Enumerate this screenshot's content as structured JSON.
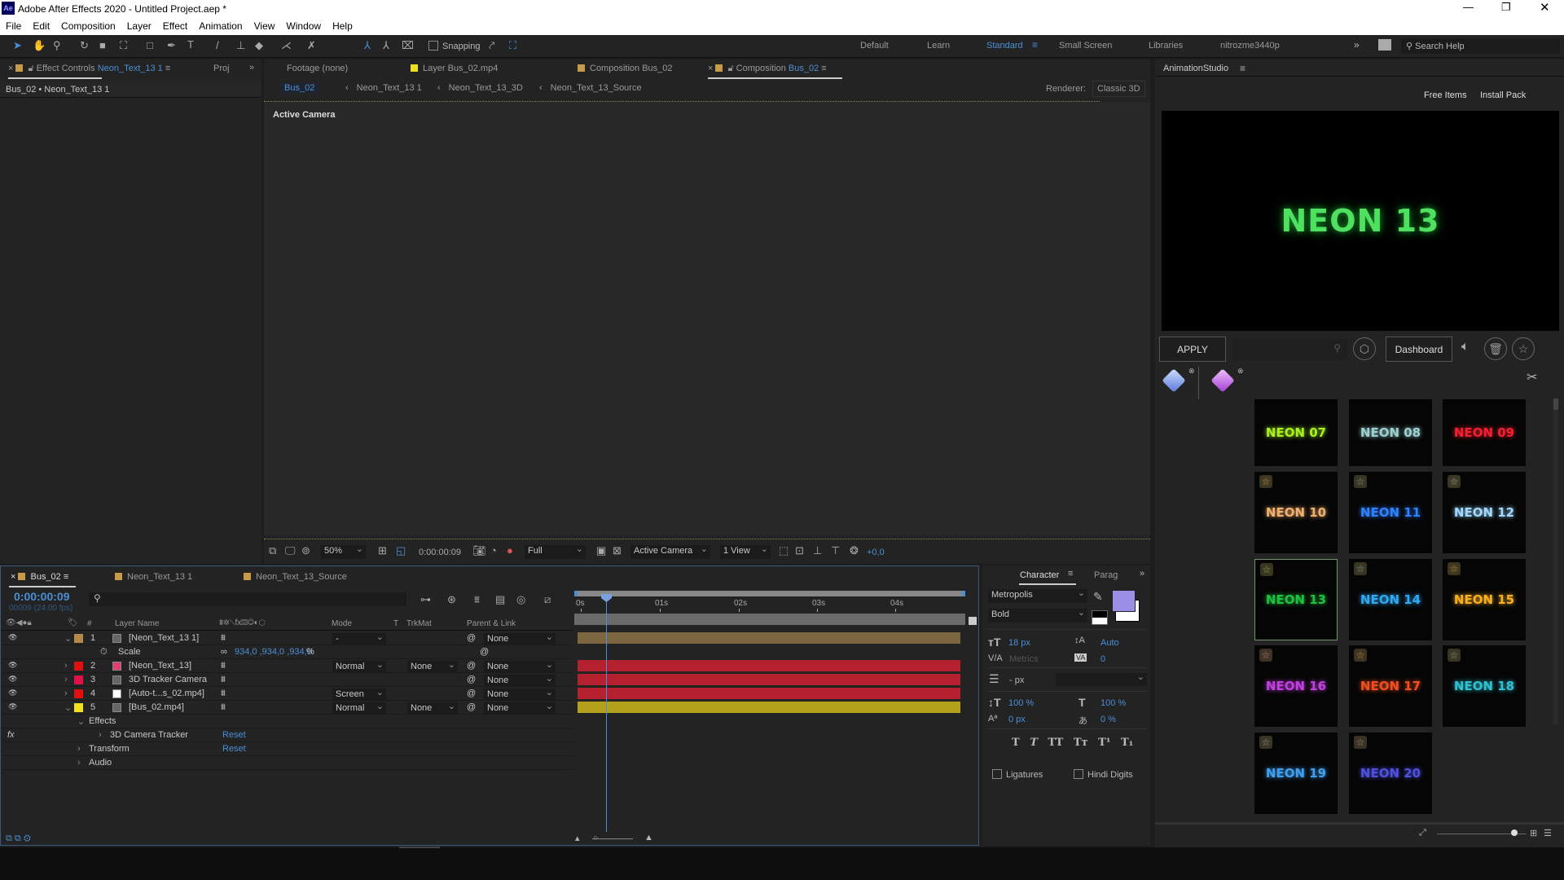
{
  "window": {
    "title": "Adobe After Effects 2020 - Untitled Project.aep *",
    "app_icon": "Ae"
  },
  "menu": [
    "File",
    "Edit",
    "Composition",
    "Layer",
    "Effect",
    "Animation",
    "View",
    "Window",
    "Help"
  ],
  "toolbar": {
    "snapping": "Snapping",
    "workspaces": [
      "Default",
      "Learn",
      "Standard",
      "Small Screen",
      "Libraries",
      "nitrozme3440p"
    ],
    "active_workspace": "Standard",
    "search_placeholder": "Search Help"
  },
  "effect_controls": {
    "tab_prefix": "Effect Controls",
    "tab_layer": "Neon_Text_13 1",
    "proj_tab": "Proj",
    "breadcrumb": "Bus_02 • Neon_Text_13 1"
  },
  "viewer": {
    "tabs": [
      "Footage (none)",
      "Layer Bus_02.mp4",
      "Composition Bus_02"
    ],
    "active_tab_prefix": "Composition",
    "active_tab_name": "Bus_02",
    "breadcrumbs": [
      "Bus_02",
      "Neon_Text_13 1",
      "Neon_Text_13_3D",
      "Neon_Text_13_Source"
    ],
    "renderer_label": "Renderer:",
    "renderer": "Classic 3D",
    "camera_label": "Active Camera",
    "zoom": "50%",
    "timecode": "0:00:00:09",
    "resolution": "Full",
    "camera": "Active Camera",
    "views": "1 View",
    "exposure": "+0,0"
  },
  "timeline": {
    "tabs": [
      "Bus_02",
      "Neon_Text_13 1",
      "Neon_Text_13_Source"
    ],
    "time": "0:00:00:09",
    "frames": "00009 (24.00 fps)",
    "columns": {
      "name": "Layer Name",
      "mode": "Mode",
      "t": "T",
      "trkmat": "TrkMat",
      "parent": "Parent & Link",
      "num": "#"
    },
    "ruler": [
      "0s",
      "01s",
      "02s",
      "03s",
      "04s"
    ],
    "playhead_time": "0:00:00:09",
    "layers": [
      {
        "num": "1",
        "name": "[Neon_Text_13 1]",
        "label": "#b48a4a",
        "mode": "-",
        "trkmat": "",
        "parent": "None",
        "bar": "#7b6640"
      },
      {
        "num": "2",
        "name": "[Neon_Text_13]",
        "label": "#e01010",
        "mode": "Normal",
        "trkmat": "None",
        "parent": "None",
        "bar": "#b5202e"
      },
      {
        "num": "3",
        "name": "3D Tracker Camera",
        "label": "#e0104a",
        "mode": "",
        "trkmat": "",
        "parent": "None",
        "bar": "#b5202e"
      },
      {
        "num": "4",
        "name": "[Auto-t...s_02.mp4]",
        "label": "#e01010",
        "mode": "Screen",
        "trkmat": "",
        "parent": "None",
        "bar": "#b5202e"
      },
      {
        "num": "5",
        "name": "[Bus_02.mp4]",
        "label": "#f0e020",
        "mode": "Normal",
        "trkmat": "None",
        "parent": "None",
        "bar": "#b5a21c"
      }
    ],
    "scale": {
      "label": "Scale",
      "value": "934,0 ,934,0 ,934,0",
      "unit": "%"
    },
    "effects": {
      "label": "Effects",
      "camera_tracker": "3D Camera Tracker",
      "transform": "Transform",
      "audio": "Audio",
      "reset": "Reset"
    }
  },
  "character": {
    "tab": "Character",
    "tab2": "Parag",
    "font": "Metropolis",
    "style": "Bold",
    "size": "18 px",
    "leading": "Auto",
    "kerning": "Metrics",
    "tracking": "0",
    "stroke": "- px",
    "vscale": "100 %",
    "hscale": "100 %",
    "baseline": "0 px",
    "tsume": "0 %",
    "ligatures": "Ligatures",
    "hindi": "Hindi Digits",
    "fill_color": "#9b8ee6"
  },
  "animation_studio": {
    "title": "AnimationStudio",
    "free_items": "Free Items",
    "install_pack": "Install Pack",
    "preview_text": "NEON 13",
    "apply": "APPLY",
    "dashboard": "Dashboard",
    "thumbs": [
      {
        "t": "NEON 07",
        "c": "#a8f020"
      },
      {
        "t": "NEON 08",
        "c": "#9ccfd0"
      },
      {
        "t": "NEON 09",
        "c": "#f02030"
      },
      {
        "t": "NEON 10",
        "c": "#f0b070"
      },
      {
        "t": "NEON 11",
        "c": "#3080ff"
      },
      {
        "t": "NEON 12",
        "c": "#a0d8ff"
      },
      {
        "t": "NEON 13",
        "c": "#20c040"
      },
      {
        "t": "NEON 14",
        "c": "#30a8f0"
      },
      {
        "t": "NEON 15",
        "c": "#f8b020"
      },
      {
        "t": "NEON 16",
        "c": "#c040e0"
      },
      {
        "t": "NEON 17",
        "c": "#f05020"
      },
      {
        "t": "NEON 18",
        "c": "#30c0d0"
      },
      {
        "t": "NEON 19",
        "c": "#40a0f0"
      },
      {
        "t": "NEON 20",
        "c": "#5050e0"
      }
    ],
    "selected": "NEON 13"
  }
}
